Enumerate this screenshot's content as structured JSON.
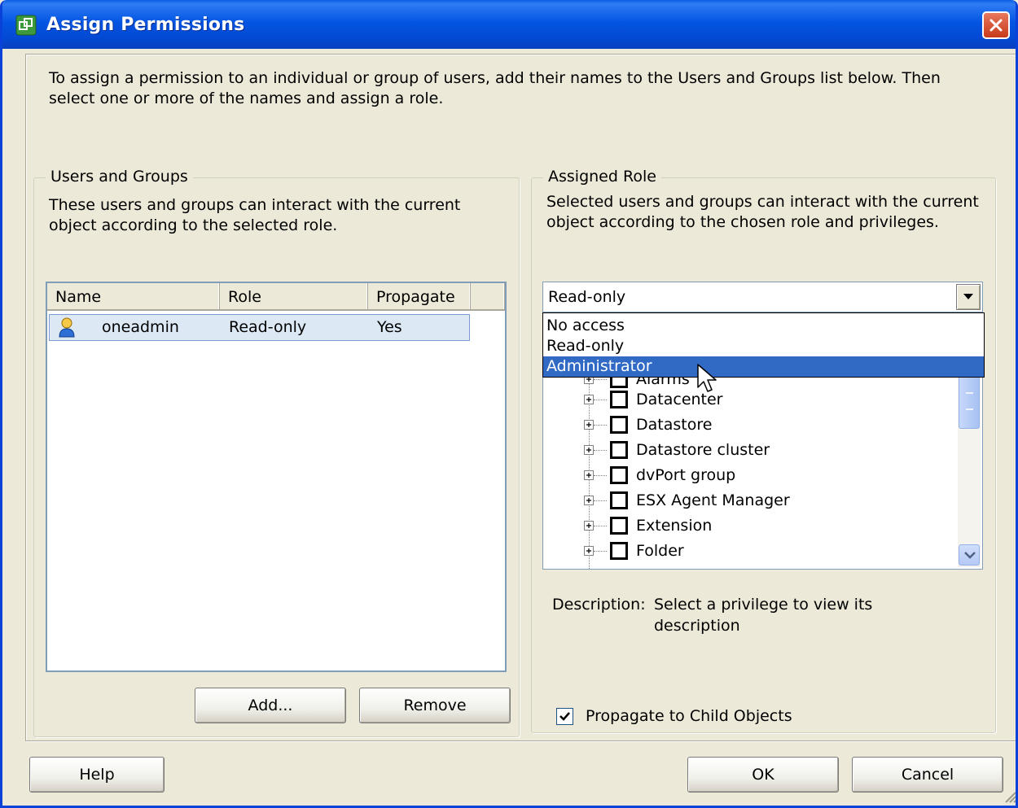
{
  "window": {
    "title": "Assign Permissions"
  },
  "intro_text": "To assign a permission to an individual or group of users, add their names to the Users and Groups list below. Then select one or more of the names and assign a role.",
  "users_groups": {
    "legend": "Users and Groups",
    "description": "These users and groups can interact with the current object according to the selected role.",
    "columns": [
      "Name",
      "Role",
      "Propagate"
    ],
    "rows": [
      {
        "name": "oneadmin",
        "role": "Read-only",
        "propagate": "Yes",
        "icon": "user-icon"
      }
    ],
    "add_label": "Add...",
    "remove_label": "Remove"
  },
  "assigned_role": {
    "legend": "Assigned Role",
    "description": "Selected users and groups can interact with the current object according to the chosen role and privileges.",
    "selected_role": "Read-only",
    "dropdown_options": [
      "No access",
      "Read-only",
      "Administrator"
    ],
    "highlighted_option": "Administrator",
    "privileges": [
      "Alarms",
      "Datacenter",
      "Datastore",
      "Datastore cluster",
      "dvPort group",
      "ESX Agent Manager",
      "Extension",
      "Folder"
    ],
    "description_label": "Description:",
    "description_value": "Select a privilege to view its description",
    "propagate_label": "Propagate to Child Objects",
    "propagate_checked": true
  },
  "footer": {
    "help_label": "Help",
    "ok_label": "OK",
    "cancel_label": "Cancel"
  }
}
